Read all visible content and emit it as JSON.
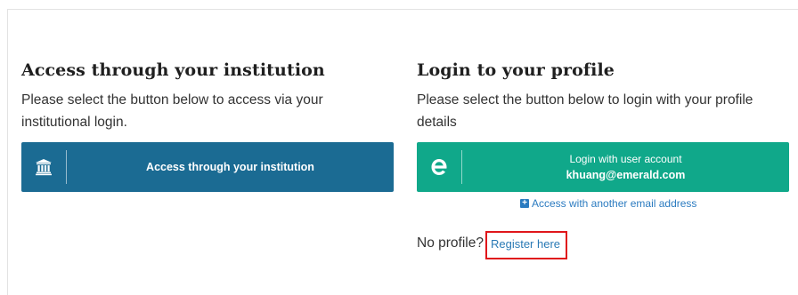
{
  "institution": {
    "heading": "Access through your institution",
    "description": "Please select the button below to access via your institutional login.",
    "button_label": "Access through your institution",
    "icon": "institution-building-icon"
  },
  "profile": {
    "heading": "Login to your profile",
    "description": "Please select the button below to login with your profile details",
    "button_line1": "Login with user account",
    "button_line2": "khuang@emerald.com",
    "icon": "emerald-e-logo-icon",
    "alt_link": "Access with another email address",
    "no_profile_text": "No profile?",
    "register_link": "Register here"
  },
  "colors": {
    "institution_button": "#1b6b93",
    "login_button": "#10a88a",
    "link": "#2b7bc0",
    "highlight_border": "#e0161b"
  }
}
